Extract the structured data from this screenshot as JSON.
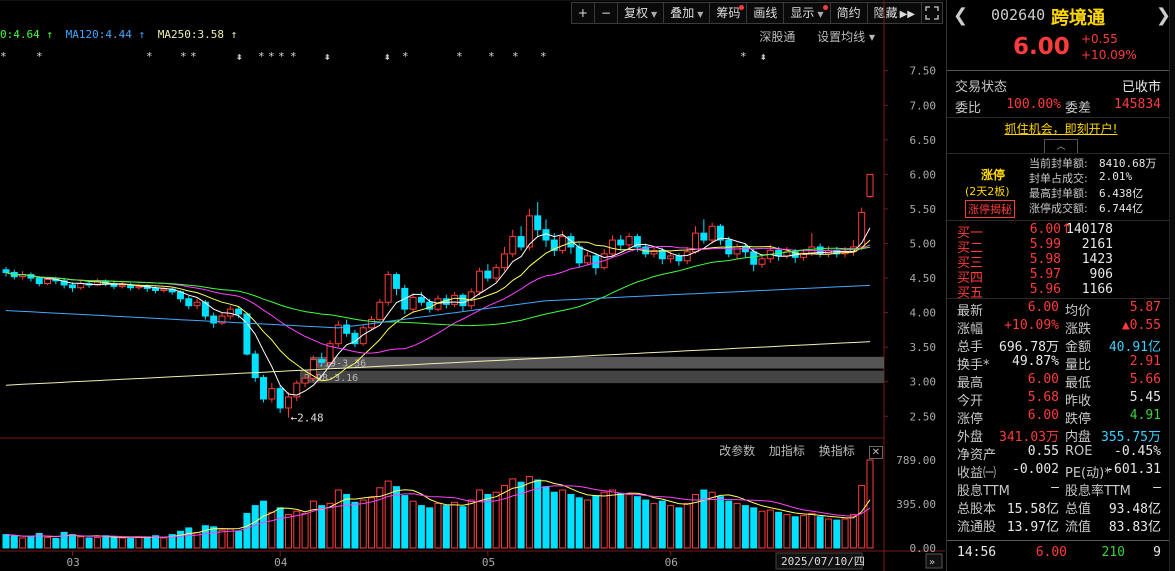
{
  "toolbar": {
    "plus": "+",
    "minus": "−",
    "fuquan": "复权",
    "diejia": "叠加",
    "chouma": "筹码",
    "huaxian": "画线",
    "xianshi": "显示",
    "jianyue": "简约",
    "yincang": "隐藏",
    "expand_icon": "expand-icon"
  },
  "ma_legend": {
    "ma60": "0:4.64 ↑",
    "ma120": "MA120:4.44 ↑",
    "ma250": "MA250:3.58 ↑"
  },
  "top_links": {
    "shengutong": "深股通",
    "set_ma": "设置均线 ▾"
  },
  "indicator_links": {
    "gai": "改参数",
    "jia": "加指标",
    "huan": "换指标",
    "close": "✕"
  },
  "price_axis": [
    "7.50",
    "7.00",
    "6.50",
    "6.00",
    "5.50",
    "5.00",
    "4.50",
    "4.00",
    "3.50",
    "3.00",
    "2.50"
  ],
  "volume_axis": [
    "789.00",
    "395.00",
    "0.00"
  ],
  "month_labels": [
    "03",
    "04",
    "05",
    "06"
  ],
  "date_cursor": "2025/07/10/四",
  "annotations": {
    "low": "2.48",
    "chip_band_1": "3.19-3.36",
    "chip_band_2": "2.98-3.16"
  },
  "colors": {
    "up": "#ff3b3b",
    "down": "#00e0ff",
    "ma_white": "#ffffff",
    "ma_yellow": "#ffff60",
    "ma_magenta": "#ff40ff",
    "ma_green": "#40ff40",
    "ma_blue": "#40a8ff",
    "ma_cream": "#f0f0b0"
  },
  "quote": {
    "code": "002640",
    "name": "跨境通",
    "price": "6.00",
    "change": "+0.55",
    "change_pct": "+10.09%",
    "trade_status_label": "交易状态",
    "trade_status": "已收市",
    "weibi_label": "委比",
    "weibi": "100.00%",
    "weicha_label": "委差",
    "weicha": "145834",
    "promo": "抓住机会，即刻开户!",
    "limit_title": "涨停",
    "limit_sub": "(2天2板)",
    "limit_btn": "涨停揭秘",
    "seal_rows": [
      {
        "label": "当前封单额:",
        "value": "8410.68万"
      },
      {
        "label": "封单占成交:",
        "value": "2.01%"
      },
      {
        "label": "最高封单额:",
        "value": "6.438亿"
      },
      {
        "label": "涨停成交额:",
        "value": "6.744亿"
      }
    ],
    "bids": [
      {
        "label": "买一",
        "price": "6.00",
        "vol": "140178",
        "arrow": "↑"
      },
      {
        "label": "买二",
        "price": "5.99",
        "vol": "2161",
        "arrow": ""
      },
      {
        "label": "买三",
        "price": "5.98",
        "vol": "1423",
        "arrow": ""
      },
      {
        "label": "买四",
        "price": "5.97",
        "vol": "906",
        "arrow": ""
      },
      {
        "label": "买五",
        "price": "5.96",
        "vol": "1166",
        "arrow": ""
      }
    ],
    "stats": [
      {
        "l1": "最新",
        "v1": "6.00",
        "c1": "red",
        "l2": "均价",
        "v2": "5.87",
        "c2": "red"
      },
      {
        "l1": "涨幅",
        "v1": "+10.09%",
        "c1": "red",
        "l2": "涨跌",
        "v2": "▲0.55",
        "c2": "red"
      },
      {
        "l1": "总手",
        "v1": "696.78万",
        "c1": "white",
        "l2": "金额",
        "v2": "40.91亿",
        "c2": "cyan"
      },
      {
        "l1": "换手*",
        "v1": "49.87%",
        "c1": "white",
        "l2": "量比",
        "v2": "2.91",
        "c2": "red"
      },
      {
        "l1": "最高",
        "v1": "6.00",
        "c1": "red",
        "l2": "最低",
        "v2": "5.66",
        "c2": "red"
      },
      {
        "l1": "今开",
        "v1": "5.68",
        "c1": "red",
        "l2": "昨收",
        "v2": "5.45",
        "c2": "white"
      },
      {
        "l1": "涨停",
        "v1": "6.00",
        "c1": "red",
        "l2": "跌停",
        "v2": "4.91",
        "c2": "green"
      },
      {
        "l1": "外盘",
        "v1": "341.03万",
        "c1": "red",
        "l2": "内盘",
        "v2": "355.75万",
        "c2": "cyan"
      },
      {
        "l1": "净资产",
        "v1": "0.55",
        "c1": "white",
        "l2": "ROE",
        "v2": "-0.45%",
        "c2": "white"
      },
      {
        "l1": "收益㈠",
        "v1": "-0.002",
        "c1": "white",
        "l2": "PE(动)*",
        "v2": "-601.31",
        "c2": "white"
      },
      {
        "l1": "股息TTM",
        "v1": "—",
        "c1": "white",
        "l2": "股息率TTM",
        "v2": "—",
        "c2": "white"
      },
      {
        "l1": "总股本",
        "v1": "15.58亿",
        "c1": "white",
        "l2": "总值",
        "v2": "93.48亿",
        "c2": "white"
      },
      {
        "l1": "流通股",
        "v1": "13.97亿",
        "c1": "white",
        "l2": "流值",
        "v2": "83.83亿",
        "c2": "white"
      }
    ],
    "tick": {
      "time": "14:56",
      "price": "6.00",
      "vol": "210",
      "count": "9"
    }
  },
  "chart_data": {
    "type": "candlestick",
    "price_ylim": [
      2.2,
      7.8
    ],
    "volume_ylim": [
      0,
      789
    ],
    "candles": [
      [
        4.62,
        4.58,
        4.66,
        4.52
      ],
      [
        4.58,
        4.52,
        4.62,
        4.48
      ],
      [
        4.52,
        4.55,
        4.6,
        4.48
      ],
      [
        4.55,
        4.5,
        4.58,
        4.45
      ],
      [
        4.5,
        4.42,
        4.53,
        4.38
      ],
      [
        4.42,
        4.48,
        4.52,
        4.4
      ],
      [
        4.48,
        4.46,
        4.52,
        4.41
      ],
      [
        4.46,
        4.4,
        4.5,
        4.35
      ],
      [
        4.4,
        4.36,
        4.44,
        4.3
      ],
      [
        4.36,
        4.42,
        4.46,
        4.33
      ],
      [
        4.42,
        4.4,
        4.46,
        4.36
      ],
      [
        4.4,
        4.45,
        4.49,
        4.38
      ],
      [
        4.45,
        4.42,
        4.48,
        4.38
      ],
      [
        4.42,
        4.38,
        4.45,
        4.34
      ],
      [
        4.38,
        4.4,
        4.44,
        4.35
      ],
      [
        4.4,
        4.36,
        4.43,
        4.32
      ],
      [
        4.36,
        4.38,
        4.42,
        4.33
      ],
      [
        4.38,
        4.35,
        4.41,
        4.3
      ],
      [
        4.35,
        4.32,
        4.38,
        4.28
      ],
      [
        4.32,
        4.34,
        4.37,
        4.29
      ],
      [
        4.34,
        4.3,
        4.36,
        4.26
      ],
      [
        4.3,
        4.2,
        4.32,
        4.15
      ],
      [
        4.2,
        4.1,
        4.24,
        4.05
      ],
      [
        4.1,
        4.15,
        4.2,
        4.05
      ],
      [
        4.15,
        3.95,
        4.18,
        3.9
      ],
      [
        3.95,
        3.85,
        4.0,
        3.78
      ],
      [
        3.85,
        3.95,
        4.0,
        3.82
      ],
      [
        3.95,
        4.05,
        4.1,
        3.9
      ],
      [
        4.05,
        3.98,
        4.08,
        3.92
      ],
      [
        3.98,
        3.4,
        4.0,
        3.38
      ],
      [
        3.4,
        3.06,
        3.45,
        3.0
      ],
      [
        3.06,
        2.75,
        3.1,
        2.7
      ],
      [
        2.75,
        2.9,
        2.98,
        2.7
      ],
      [
        2.9,
        2.62,
        2.95,
        2.55
      ],
      [
        2.62,
        2.78,
        2.85,
        2.48
      ],
      [
        2.78,
        2.98,
        3.02,
        2.72
      ],
      [
        2.98,
        3.05,
        3.1,
        2.92
      ],
      [
        3.05,
        3.32,
        3.38,
        3.0
      ],
      [
        3.32,
        3.28,
        3.42,
        3.22
      ],
      [
        3.28,
        3.55,
        3.6,
        3.25
      ],
      [
        3.55,
        3.82,
        3.88,
        3.5
      ],
      [
        3.82,
        3.7,
        3.9,
        3.65
      ],
      [
        3.7,
        3.55,
        3.75,
        3.5
      ],
      [
        3.55,
        3.78,
        3.82,
        3.52
      ],
      [
        3.78,
        3.9,
        3.95,
        3.75
      ],
      [
        3.9,
        4.15,
        4.2,
        3.88
      ],
      [
        4.15,
        4.55,
        4.6,
        4.1
      ],
      [
        4.55,
        4.35,
        4.58,
        4.25
      ],
      [
        4.35,
        4.05,
        4.4,
        3.98
      ],
      [
        4.05,
        4.22,
        4.28,
        4.0
      ],
      [
        4.22,
        4.15,
        4.3,
        4.1
      ],
      [
        4.15,
        4.05,
        4.2,
        4.0
      ],
      [
        4.05,
        4.2,
        4.25,
        4.02
      ],
      [
        4.2,
        4.12,
        4.26,
        4.06
      ],
      [
        4.12,
        4.25,
        4.3,
        4.08
      ],
      [
        4.25,
        4.1,
        4.28,
        4.02
      ],
      [
        4.1,
        4.3,
        4.35,
        4.05
      ],
      [
        4.3,
        4.6,
        4.65,
        4.25
      ],
      [
        4.6,
        4.5,
        4.7,
        4.45
      ],
      [
        4.5,
        4.65,
        4.7,
        4.45
      ],
      [
        4.65,
        4.85,
        4.95,
        4.6
      ],
      [
        4.85,
        5.1,
        5.2,
        4.8
      ],
      [
        5.1,
        4.95,
        5.25,
        4.9
      ],
      [
        4.95,
        5.4,
        5.5,
        4.9
      ],
      [
        5.4,
        5.2,
        5.6,
        5.1
      ],
      [
        5.2,
        5.05,
        5.35,
        4.95
      ],
      [
        5.05,
        4.9,
        5.15,
        4.82
      ],
      [
        4.9,
        5.1,
        5.18,
        4.85
      ],
      [
        5.1,
        4.95,
        5.15,
        4.85
      ],
      [
        4.95,
        4.72,
        5.0,
        4.65
      ],
      [
        4.72,
        4.82,
        4.88,
        4.68
      ],
      [
        4.82,
        4.65,
        4.86,
        4.55
      ],
      [
        4.65,
        4.85,
        4.92,
        4.62
      ],
      [
        4.85,
        5.05,
        5.12,
        4.8
      ],
      [
        5.05,
        4.98,
        5.12,
        4.9
      ],
      [
        4.98,
        5.1,
        5.15,
        4.92
      ],
      [
        5.1,
        4.95,
        5.14,
        4.88
      ],
      [
        4.95,
        4.85,
        5.0,
        4.8
      ],
      [
        4.85,
        4.9,
        4.95,
        4.8
      ],
      [
        4.9,
        4.78,
        4.94,
        4.7
      ],
      [
        4.78,
        4.82,
        4.88,
        4.72
      ],
      [
        4.82,
        4.75,
        4.86,
        4.68
      ],
      [
        4.75,
        4.88,
        4.95,
        4.7
      ],
      [
        4.88,
        5.15,
        5.25,
        4.85
      ],
      [
        5.15,
        5.05,
        5.35,
        5.0
      ],
      [
        5.05,
        5.25,
        5.3,
        5.0
      ],
      [
        5.25,
        5.05,
        5.28,
        4.98
      ],
      [
        5.05,
        4.85,
        5.1,
        4.8
      ],
      [
        4.85,
        4.95,
        5.0,
        4.78
      ],
      [
        4.95,
        4.88,
        5.0,
        4.8
      ],
      [
        4.88,
        4.7,
        4.92,
        4.6
      ],
      [
        4.7,
        4.78,
        4.85,
        4.65
      ],
      [
        4.78,
        4.9,
        4.98,
        4.72
      ],
      [
        4.9,
        4.82,
        4.95,
        4.75
      ],
      [
        4.82,
        4.88,
        4.95,
        4.78
      ],
      [
        4.88,
        4.8,
        4.92,
        4.72
      ],
      [
        4.8,
        4.86,
        4.92,
        4.75
      ],
      [
        4.86,
        4.95,
        5.15,
        4.82
      ],
      [
        4.95,
        4.85,
        5.0,
        4.8
      ],
      [
        4.85,
        4.9,
        4.96,
        4.8
      ],
      [
        4.9,
        4.85,
        4.95,
        4.8
      ],
      [
        4.85,
        4.88,
        4.95,
        4.8
      ],
      [
        4.88,
        4.95,
        5.05,
        4.82
      ],
      [
        4.95,
        5.45,
        5.52,
        4.9
      ],
      [
        5.68,
        6.0,
        6.0,
        5.66
      ]
    ],
    "volumes": [
      120,
      110,
      90,
      100,
      130,
      95,
      85,
      140,
      120,
      100,
      90,
      95,
      110,
      100,
      90,
      85,
      95,
      100,
      110,
      90,
      120,
      150,
      180,
      140,
      200,
      190,
      160,
      170,
      150,
      310,
      380,
      420,
      320,
      360,
      300,
      330,
      310,
      420,
      380,
      400,
      520,
      480,
      410,
      430,
      450,
      540,
      600,
      550,
      470,
      420,
      380,
      360,
      400,
      380,
      410,
      370,
      430,
      520,
      480,
      500,
      560,
      620,
      590,
      640,
      610,
      550,
      500,
      520,
      480,
      450,
      430,
      470,
      500,
      520,
      490,
      480,
      460,
      430,
      400,
      420,
      380,
      360,
      400,
      480,
      520,
      500,
      460,
      420,
      400,
      380,
      360,
      330,
      340,
      320,
      300,
      280,
      290,
      310,
      280,
      260,
      250,
      260,
      300,
      560,
      789
    ],
    "price_levels": [
      "7.50",
      "7.00",
      "6.50",
      "6.00",
      "5.50",
      "5.00",
      "4.50",
      "4.00",
      "3.50",
      "3.00",
      "2.50"
    ]
  }
}
